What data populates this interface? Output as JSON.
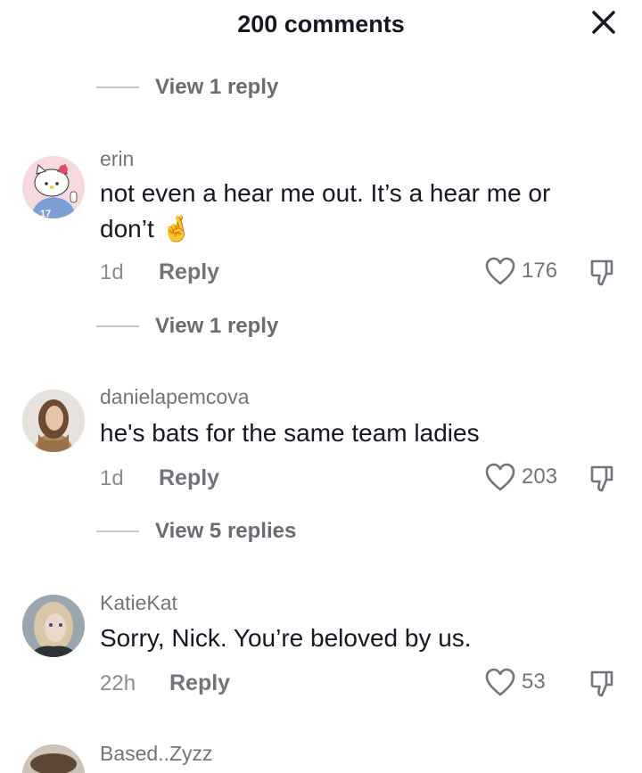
{
  "header": {
    "title": "200 comments"
  },
  "thread_top": {
    "view_replies": "View 1 reply"
  },
  "comments": [
    {
      "username": "erin",
      "text_line1": "not even a hear me out. It’s a hear me or",
      "text_line2": "don’t",
      "emoji": "🤞",
      "time": "1d",
      "reply": "Reply",
      "likes": "176",
      "view_replies": "View 1 reply",
      "avatar_badge": "17"
    },
    {
      "username": "danielapemcova",
      "text": "he's bats for the same team ladies",
      "time": "1d",
      "reply": "Reply",
      "likes": "203",
      "view_replies": "View 5 replies"
    },
    {
      "username": "KatieKat",
      "text": "Sorry, Nick. You’re beloved by us.",
      "time": "22h",
      "reply": "Reply",
      "likes": "53"
    },
    {
      "username": "Based..Zyzz"
    }
  ],
  "icons": {
    "close": "close-icon",
    "like": "heart-outline-icon",
    "dislike": "thumbs-down-icon"
  },
  "colors": {
    "primary_text": "#161823",
    "secondary_text": "#73747b",
    "divider": "#c7c7c9"
  }
}
